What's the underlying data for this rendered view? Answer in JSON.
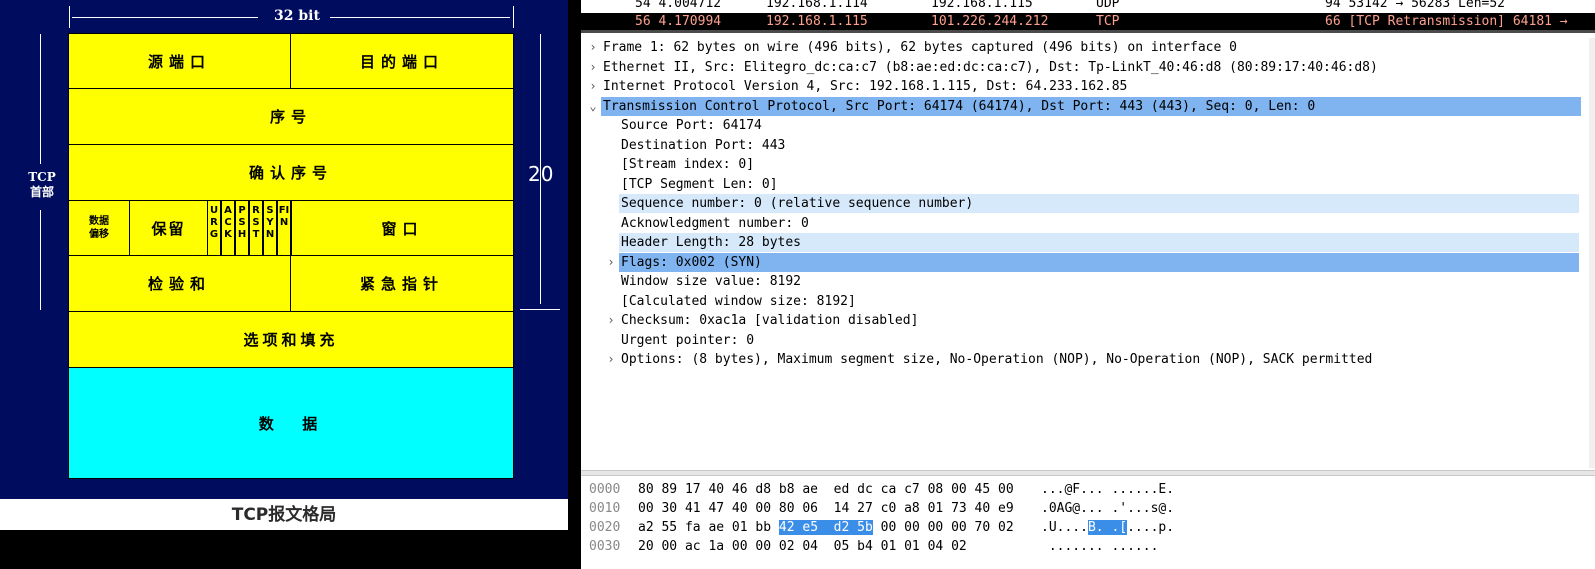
{
  "diagram": {
    "width_label": "32 bit",
    "height_label": "20",
    "side_label": "TCP\n首部",
    "rows": {
      "src_port": "源端口",
      "dst_port": "目的端口",
      "seq": "序号",
      "ack": "确认序号",
      "offset": "数据\n偏移",
      "reserved": "保留",
      "flags": [
        "URG",
        "ACK",
        "PSH",
        "RST",
        "SYN",
        "FIN"
      ],
      "window": "窗口",
      "checksum": "检验和",
      "urgent": "紧急指针",
      "options": "选项和填充",
      "data": "数  据"
    },
    "caption": "TCP报文格局"
  },
  "packet_list": [
    {
      "no_time": "54 4.004712",
      "src": "192.168.1.114",
      "dst": "192.168.1.115",
      "proto": "UDP",
      "info": "94 53142 → 56283  Len=52"
    },
    {
      "no_time": "56 4.170994",
      "src": "192.168.1.115",
      "dst": "101.226.244.212",
      "proto": "TCP",
      "info": "66 [TCP Retransmission] 64181 →"
    }
  ],
  "tree": [
    {
      "indent": 0,
      "toggle": "›",
      "text": "Frame 1: 62 bytes on wire (496 bits), 62 bytes captured (496 bits) on interface 0",
      "hl": ""
    },
    {
      "indent": 0,
      "toggle": "›",
      "text": "Ethernet II, Src: Elitegro_dc:ca:c7 (b8:ae:ed:dc:ca:c7), Dst: Tp-LinkT_40:46:d8 (80:89:17:40:46:d8)",
      "hl": ""
    },
    {
      "indent": 0,
      "toggle": "›",
      "text": "Internet Protocol Version 4, Src: 192.168.1.115, Dst: 64.233.162.85",
      "hl": ""
    },
    {
      "indent": 0,
      "toggle": "˅",
      "text": "Transmission Control Protocol, Src Port: 64174 (64174), Dst Port: 443 (443), Seq: 0, Len: 0",
      "hl": "blue"
    },
    {
      "indent": 1,
      "toggle": "",
      "text": "Source Port: 64174",
      "hl": ""
    },
    {
      "indent": 1,
      "toggle": "",
      "text": "Destination Port: 443",
      "hl": ""
    },
    {
      "indent": 1,
      "toggle": "",
      "text": "[Stream index: 0]",
      "hl": ""
    },
    {
      "indent": 1,
      "toggle": "",
      "text": "[TCP Segment Len: 0]",
      "hl": ""
    },
    {
      "indent": 1,
      "toggle": "",
      "text": "Sequence number: 0    (relative sequence number)",
      "hl": "light"
    },
    {
      "indent": 1,
      "toggle": "",
      "text": "Acknowledgment number: 0",
      "hl": ""
    },
    {
      "indent": 1,
      "toggle": "",
      "text": "Header Length: 28 bytes",
      "hl": "light"
    },
    {
      "indent": 1,
      "toggle": "›",
      "text": "Flags: 0x002 (SYN)",
      "hl": "blue"
    },
    {
      "indent": 1,
      "toggle": "",
      "text": "Window size value: 8192",
      "hl": ""
    },
    {
      "indent": 1,
      "toggle": "",
      "text": "[Calculated window size: 8192]",
      "hl": ""
    },
    {
      "indent": 1,
      "toggle": "›",
      "text": "Checksum: 0xac1a [validation disabled]",
      "hl": ""
    },
    {
      "indent": 1,
      "toggle": "",
      "text": "Urgent pointer: 0",
      "hl": ""
    },
    {
      "indent": 1,
      "toggle": "›",
      "text": "Options: (8 bytes), Maximum segment size, No-Operation (NOP), No-Operation (NOP), SACK permitted",
      "hl": ""
    }
  ],
  "hex": [
    {
      "offset": "0000",
      "pre": "80 89 17 40 46 d8 b8 ae  ed dc ca c7 08 00 45 00",
      "sel": "",
      "post": "",
      "apre": "...@F... ......E.",
      "asel": "",
      "apost": ""
    },
    {
      "offset": "0010",
      "pre": "00 30 41 47 40 00 80 06  14 27 c0 a8 01 73 40 e9",
      "sel": "",
      "post": "",
      "apre": ".0AG@... .'...s@.",
      "asel": "",
      "apost": ""
    },
    {
      "offset": "0020",
      "pre": "a2 55 fa ae 01 bb ",
      "sel": "42 e5  d2 5b",
      "post": " 00 00 00 00 70 02",
      "apre": ".U....",
      "asel": "B. .[",
      "apost": "....p."
    },
    {
      "offset": "0030",
      "pre": "20 00 ac 1a 00 00 02 04  05 b4 01 01 04 02",
      "sel": "",
      "post": "",
      "apre": " ....... ......",
      "asel": "",
      "apost": ""
    }
  ]
}
